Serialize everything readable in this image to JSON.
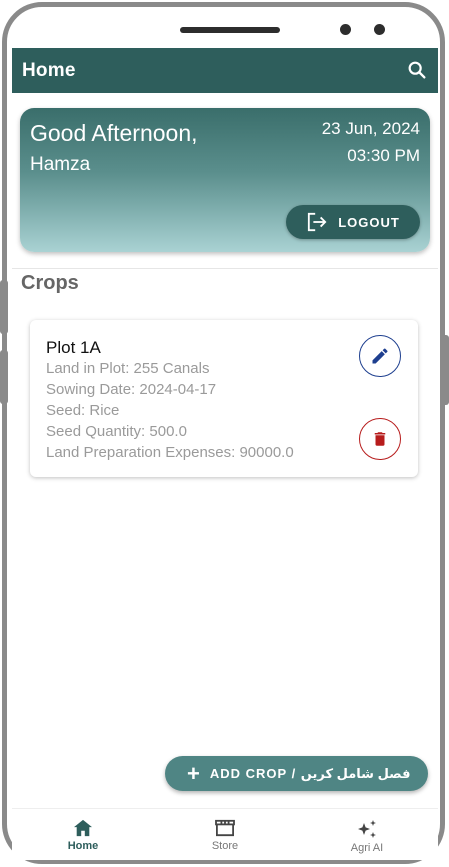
{
  "appbar": {
    "title": "Home",
    "search_icon": "search-icon"
  },
  "greeting": {
    "salutation": "Good Afternoon,",
    "user_name": "Hamza",
    "date": "23 Jun, 2024",
    "time": "03:30 PM",
    "logout_label": "LOGOUT",
    "logout_icon": "logout-icon"
  },
  "crops_section": {
    "title": "Crops"
  },
  "crops": [
    {
      "plot": "Plot 1A",
      "land": "Land in Plot: 255 Canals",
      "sowing_date": "Sowing Date: 2024-04-17",
      "seed": "Seed: Rice",
      "seed_quantity": "Seed Quantity: 500.0",
      "land_prep_expenses": "Land Preparation Expenses: 90000.0",
      "edit_icon": "edit-icon",
      "delete_icon": "delete-icon"
    }
  ],
  "fab": {
    "label": "ADD CROP / فصل شامل کریں",
    "icon": "plus-icon"
  },
  "bottom_nav": [
    {
      "label": "Home",
      "icon": "home-icon",
      "active": true
    },
    {
      "label": "Store",
      "icon": "store-icon",
      "active": false
    },
    {
      "label": "Agri AI",
      "icon": "sparkles-icon",
      "active": false
    }
  ],
  "colors": {
    "primary": "#2e5e5c",
    "fab": "#4f8584",
    "edit_accent": "#1e3f8f",
    "delete_accent": "#b71c1c"
  }
}
